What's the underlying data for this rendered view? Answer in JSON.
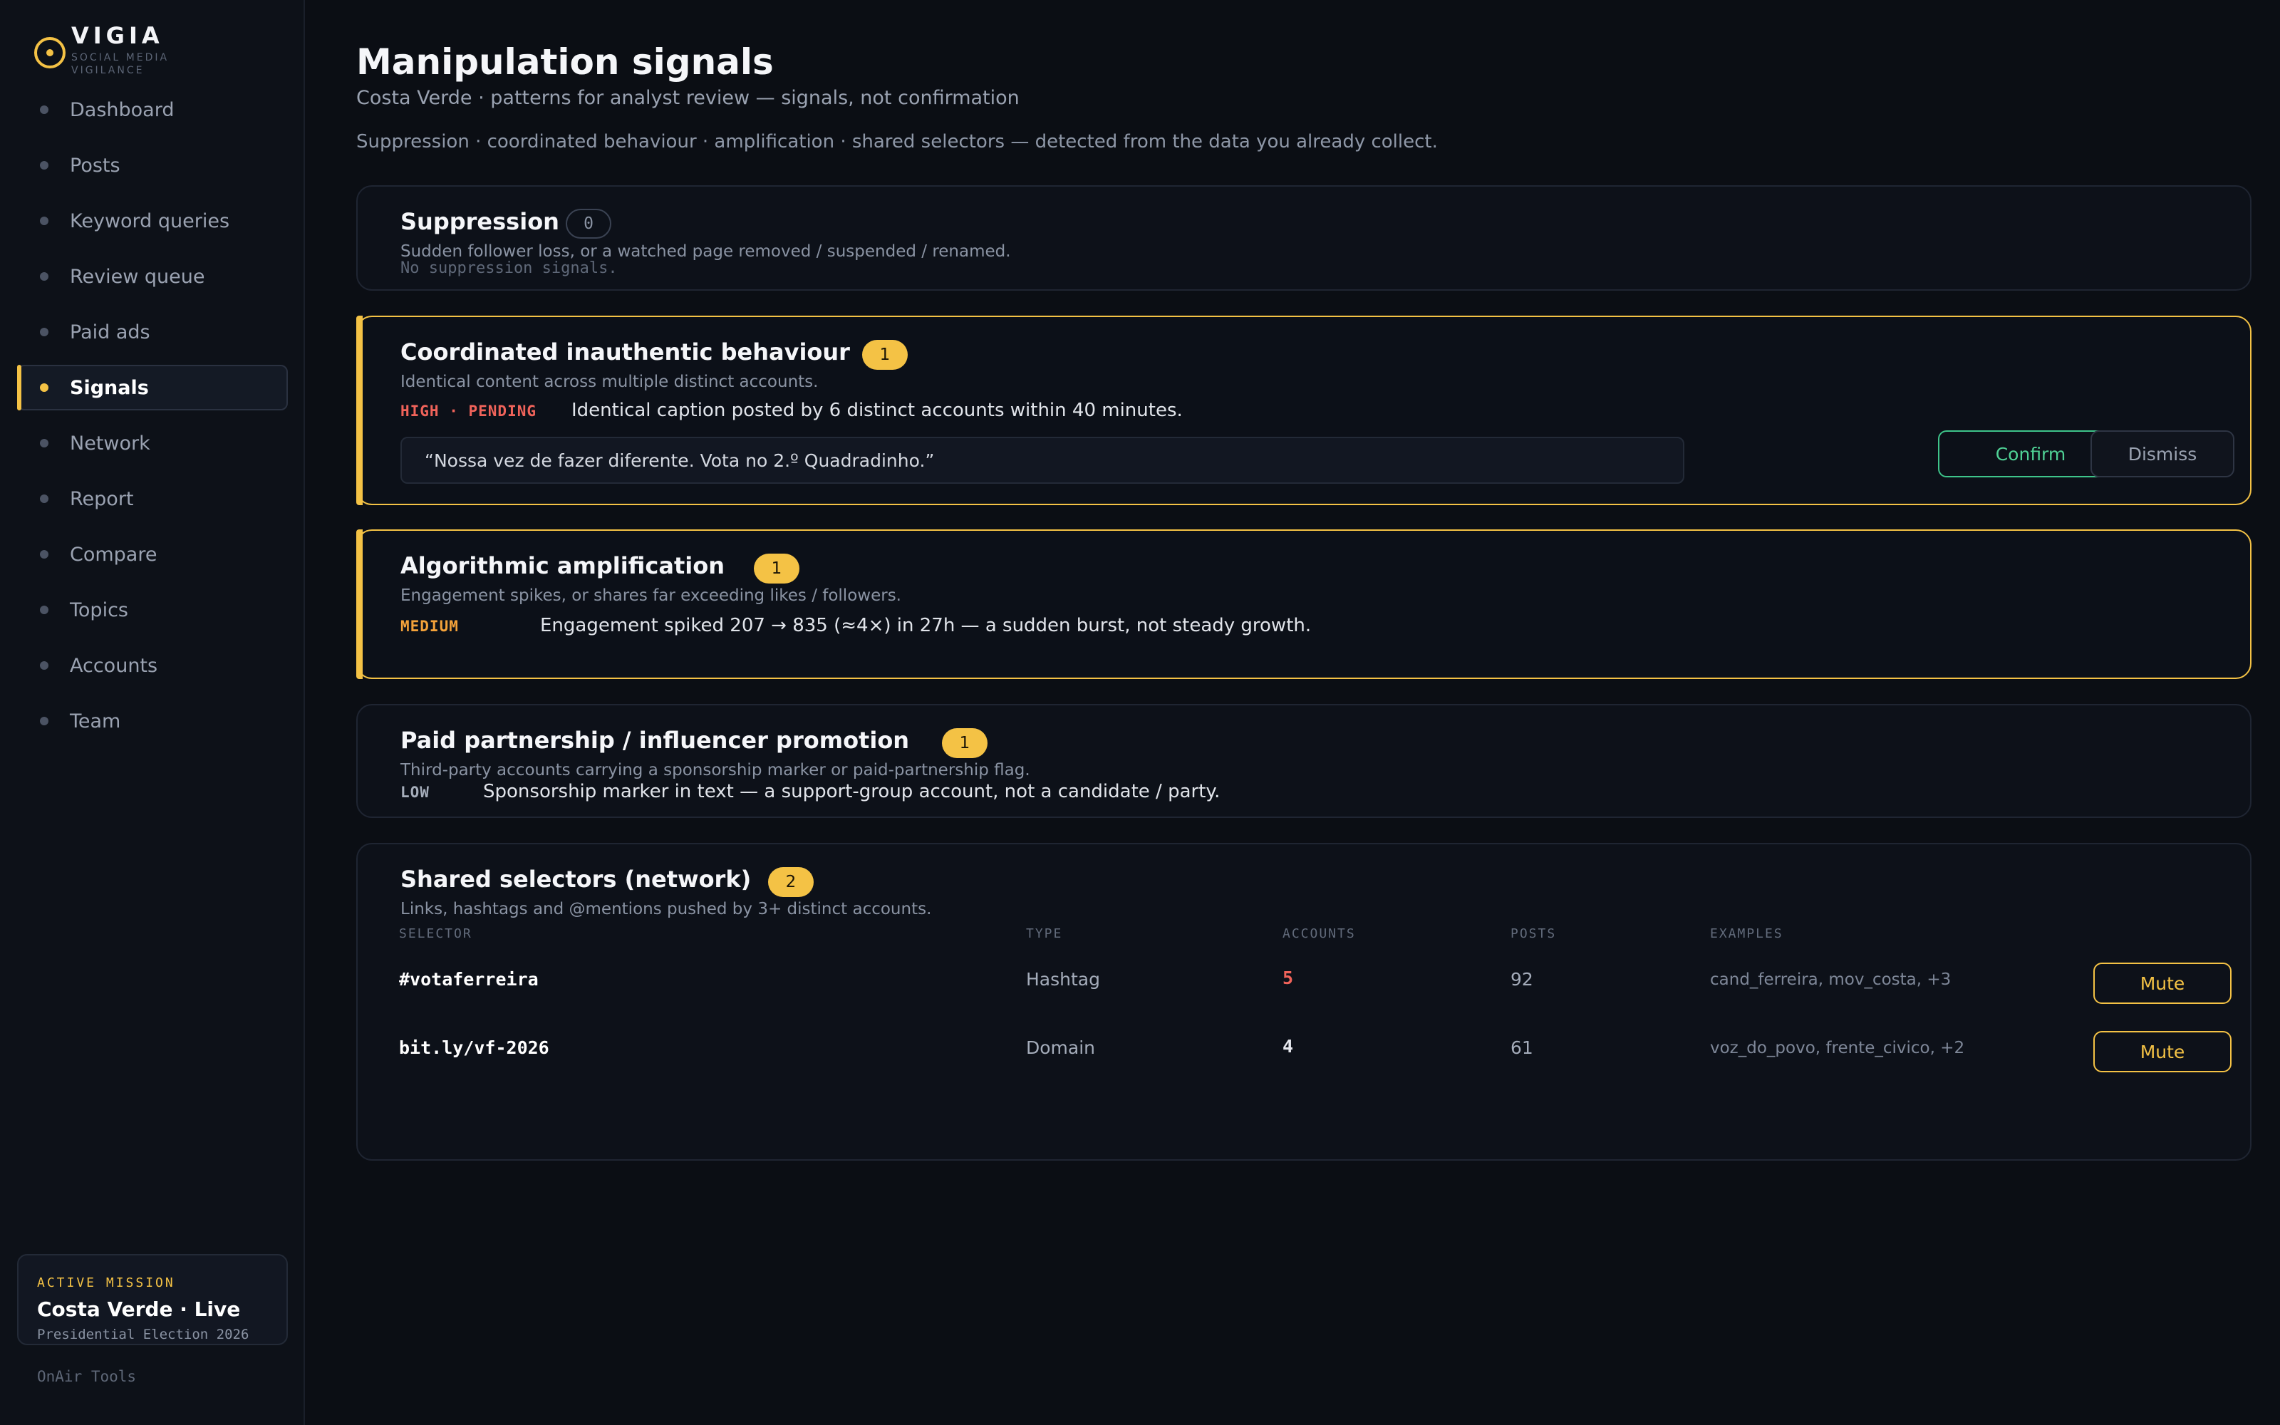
{
  "brand": {
    "name": "VIGIA",
    "subtitle": "SOCIAL MEDIA VIGILANCE",
    "logo_icon": "eye-circle-icon"
  },
  "nav": {
    "items": [
      {
        "label": "Dashboard",
        "active": false
      },
      {
        "label": "Posts",
        "active": false
      },
      {
        "label": "Keyword queries",
        "active": false
      },
      {
        "label": "Review queue",
        "active": false
      },
      {
        "label": "Paid ads",
        "active": false
      },
      {
        "label": "Signals",
        "active": true
      },
      {
        "label": "Network",
        "active": false
      },
      {
        "label": "Report",
        "active": false
      },
      {
        "label": "Compare",
        "active": false
      },
      {
        "label": "Topics",
        "active": false
      },
      {
        "label": "Accounts",
        "active": false
      },
      {
        "label": "Team",
        "active": false
      }
    ]
  },
  "mission": {
    "kicker": "ACTIVE MISSION",
    "title": "Costa Verde · Live",
    "subtitle": "Presidential Election 2026"
  },
  "footer": {
    "tools": "OnAir Tools"
  },
  "page": {
    "title": "Manipulation signals",
    "subtitle": "Costa Verde · patterns for analyst review — signals, not confirmation",
    "description": "Suppression · coordinated behaviour · amplification · shared selectors — detected from the data you already collect."
  },
  "suppression": {
    "title": "Suppression",
    "count": "0",
    "description": "Sudden follower loss, or a watched page removed / suspended / renamed.",
    "empty": "No suppression signals."
  },
  "coordinated": {
    "title": "Coordinated inauthentic behaviour",
    "count": "1",
    "description": "Identical content across multiple distinct accounts.",
    "severity": "HIGH · PENDING",
    "finding": "Identical caption posted by 6 distinct accounts within 40 minutes.",
    "quote": "“Nossa vez de fazer diferente. Vota no 2.º Quadradinho.”",
    "confirm_label": "Confirm",
    "dismiss_label": "Dismiss"
  },
  "amplification": {
    "title": "Algorithmic amplification",
    "count": "1",
    "description": "Engagement spikes, or shares far exceeding likes / followers.",
    "severity": "MEDIUM",
    "finding": "Engagement spiked 207 → 835 (≈4×) in 27h — a sudden burst, not steady growth."
  },
  "paid": {
    "title": "Paid partnership / influencer promotion",
    "count": "1",
    "description": "Third-party accounts carrying a sponsorship marker or paid-partnership flag.",
    "severity": "LOW",
    "finding": "Sponsorship marker in text — a support-group account, not a candidate / party."
  },
  "selectors": {
    "title": "Shared selectors (network)",
    "count": "2",
    "description": "Links, hashtags and @mentions pushed by 3+ distinct accounts.",
    "columns": [
      "SELECTOR",
      "TYPE",
      "ACCOUNTS",
      "POSTS",
      "EXAMPLES"
    ],
    "rows": [
      {
        "selector": "#votaferreira",
        "type": "Hashtag",
        "accounts": "5",
        "posts": "92",
        "examples": "cand_ferreira, mov_costa, +3",
        "action": "Mute"
      },
      {
        "selector": "bit.ly/vf-2026",
        "type": "Domain",
        "accounts": "4",
        "posts": "61",
        "examples": "voz_do_povo, frente_civico, +2",
        "action": "Mute"
      }
    ]
  },
  "colors": {
    "accent": "#f4c245",
    "danger": "#f0635a",
    "warning": "#f4a23a",
    "success": "#3ec48a",
    "background": "#0b0e14"
  }
}
